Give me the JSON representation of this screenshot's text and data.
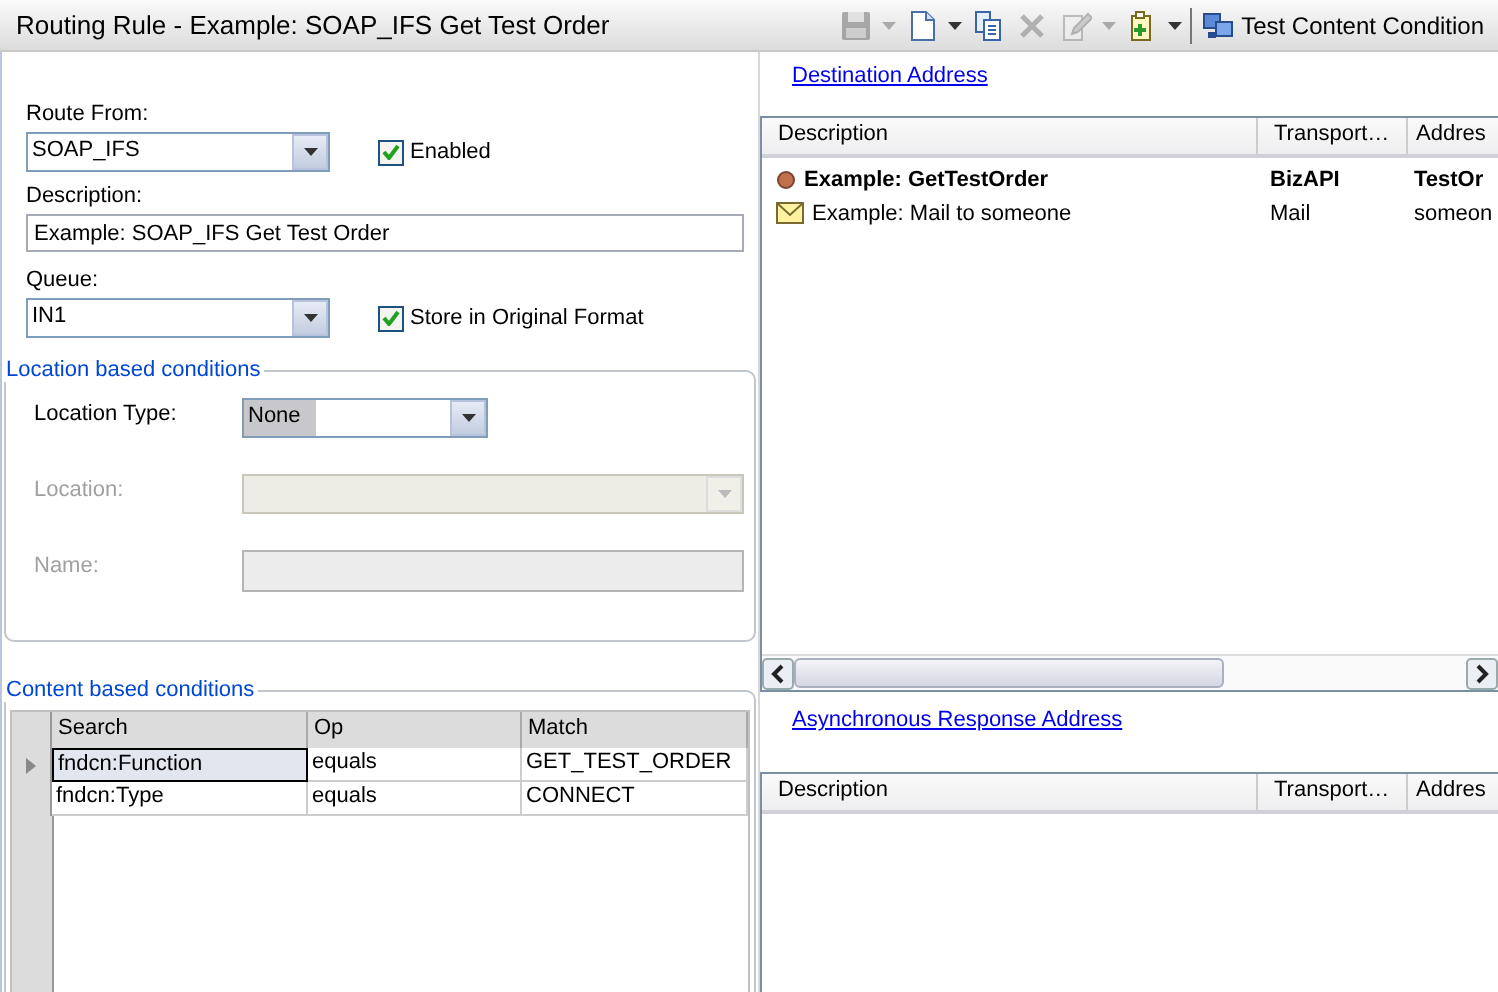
{
  "window": {
    "title": "Routing Rule - Example: SOAP_IFS Get Test Order"
  },
  "toolbar": [
    {
      "kind": "save",
      "disabled": true,
      "dropdown": true
    },
    {
      "kind": "new",
      "disabled": false,
      "dropdown": true
    },
    {
      "kind": "copy",
      "disabled": false,
      "dropdown": false
    },
    {
      "kind": "delete",
      "disabled": true,
      "dropdown": false
    },
    {
      "kind": "edit",
      "disabled": true,
      "dropdown": true
    },
    {
      "kind": "add",
      "disabled": false,
      "dropdown": true
    },
    {
      "kind": "test",
      "disabled": false,
      "dropdown": false,
      "label": "Test Content Condition"
    }
  ],
  "form": {
    "route_from": {
      "label": "Route From:",
      "value": "SOAP_IFS"
    },
    "enabled": {
      "label": "Enabled",
      "checked": true
    },
    "description": {
      "label": "Description:",
      "value": "Example: SOAP_IFS Get Test Order"
    },
    "queue": {
      "label": "Queue:",
      "value": "IN1"
    },
    "store_original": {
      "label": "Store in Original Format",
      "checked": true
    }
  },
  "location_group": {
    "title": "Location based conditions",
    "fields": [
      {
        "kind": "combo",
        "label": "Location Type:",
        "value": "None",
        "disabled": false
      },
      {
        "kind": "combo",
        "label": "Location:",
        "disabled": true
      },
      {
        "kind": "text",
        "label": "Name:",
        "disabled": true
      }
    ]
  },
  "content_group": {
    "title": "Content based conditions",
    "columns": [
      "Search",
      "Op",
      "Match"
    ],
    "rows": [
      {
        "selected": true,
        "cells": [
          "fndcn:Function",
          "equals",
          "GET_TEST_ORDER"
        ]
      },
      {
        "selected": false,
        "cells": [
          "fndcn:Type",
          "equals",
          "CONNECT"
        ]
      }
    ]
  },
  "destination": {
    "link": "Destination Address",
    "columns": [
      "Description",
      "Transport…",
      "Addres"
    ],
    "rows": [
      {
        "kind": "api",
        "cells": [
          "Example: GetTestOrder",
          "BizAPI",
          "TestOr"
        ]
      },
      {
        "kind": "mail",
        "cells": [
          "Example: Mail to someone",
          "Mail",
          "someon"
        ]
      }
    ]
  },
  "async_response": {
    "link": "Asynchronous Response Address",
    "columns": [
      "Description",
      "Transport…",
      "Addres"
    ]
  }
}
